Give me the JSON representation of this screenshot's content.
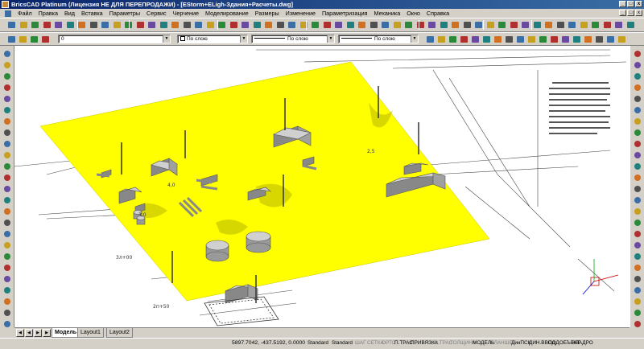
{
  "window": {
    "title": "BricsCAD Platinum (Лицензия НЕ ДЛЯ ПЕРЕПРОДАЖИ) - [EStorm+ELigh-Здания+Расчеты.dwg]"
  },
  "menu": [
    "Файл",
    "Правка",
    "Вид",
    "Вставка",
    "Параметры",
    "Сервис",
    "Черчение",
    "Моделирование",
    "Размеры",
    "Изменение",
    "Параметризация",
    "Механика",
    "Окно",
    "Справка"
  ],
  "properties": {
    "layer": "0",
    "color": "По слою",
    "linetype": "По слою",
    "lineweight": "По слою"
  },
  "tabs": [
    "Модель",
    "Layout1",
    "Layout2"
  ],
  "status": {
    "coordinates": "5897.7042, -437.5192, 0.0000",
    "text_style": "Standard",
    "dim_style": "Standard",
    "toggles": [
      {
        "label": "ШАГ",
        "on": false
      },
      {
        "label": "СЕТКА",
        "on": false
      },
      {
        "label": "ОРТО",
        "on": false
      },
      {
        "label": "П.ТРАС",
        "on": true
      },
      {
        "label": "ПРИВЯЗКА",
        "on": true
      },
      {
        "label": "О.ТРАС",
        "on": false
      },
      {
        "label": "ТОЛЩИНА",
        "on": false
      },
      {
        "label": "МОДЕЛЬ",
        "on": true
      },
      {
        "label": "ПЛАНШЕТ",
        "on": false
      },
      {
        "label": "ДинПСК",
        "on": true
      },
      {
        "label": "ДИН.ВВОД",
        "on": true
      },
      {
        "label": "ПОДОБЪЕКТ",
        "on": true
      },
      {
        "label": "КВАДРО",
        "on": true
      }
    ]
  },
  "drawing": {
    "surface_color": "#ffff00",
    "labels": [
      "3,0",
      "2,5",
      "4,0",
      "2п+50",
      "3л+00"
    ]
  }
}
